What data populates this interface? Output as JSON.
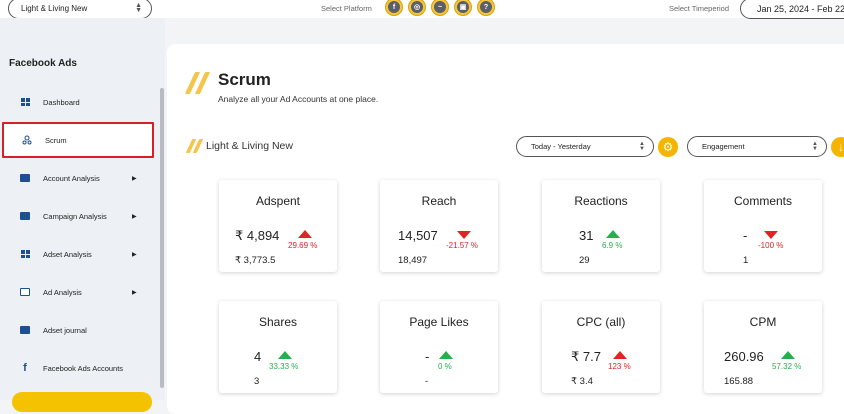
{
  "topbar": {
    "brand_select": "Light & Living New",
    "select_platform_label": "Select Platform",
    "platform_icons": [
      "facebook-icon",
      "instagram-icon",
      "messenger-icon",
      "chat-icon",
      "help-icon"
    ],
    "select_timeperiod_label": "Select Timeperiod",
    "date_range": "Jan 25, 2024 - Feb 22,"
  },
  "sidebar": {
    "title": "Facebook Ads",
    "items": [
      {
        "label": "Dashboard",
        "icon": "dashboard-icon",
        "arrow": ""
      },
      {
        "label": "Scrum",
        "icon": "scrum-icon",
        "arrow": ""
      },
      {
        "label": "Account Analysis",
        "icon": "account-icon",
        "arrow": "▶"
      },
      {
        "label": "Campaign Analysis",
        "icon": "campaign-icon",
        "arrow": "▶"
      },
      {
        "label": "Adset Analysis",
        "icon": "adset-icon",
        "arrow": "▶"
      },
      {
        "label": "Ad Analysis",
        "icon": "ad-icon",
        "arrow": "▶"
      },
      {
        "label": "Adset journal",
        "icon": "journal-icon",
        "arrow": ""
      },
      {
        "label": "Facebook Ads Accounts",
        "icon": "facebook-icon",
        "arrow": ""
      }
    ]
  },
  "main": {
    "title": "Scrum",
    "subtitle": "Analyze all your Ad Accounts at one place.",
    "account_name": "Light & Living New",
    "period_select": "Today - Yesterday",
    "metric_select": "Engagement"
  },
  "cards": [
    {
      "title": "Adspent",
      "value": "₹ 4,894",
      "prev": "₹ 3,773.5",
      "pct": "29.69 %",
      "trend": "up",
      "color": "red"
    },
    {
      "title": "Reach",
      "value": "14,507",
      "prev": "18,497",
      "pct": "-21.57 %",
      "trend": "down",
      "color": "red"
    },
    {
      "title": "Reactions",
      "value": "31",
      "prev": "29",
      "pct": "6.9 %",
      "trend": "up",
      "color": "green"
    },
    {
      "title": "Comments",
      "value": "-",
      "prev": "1",
      "pct": "-100 %",
      "trend": "down",
      "color": "red"
    },
    {
      "title": "Shares",
      "value": "4",
      "prev": "3",
      "pct": "33.33 %",
      "trend": "up",
      "color": "green"
    },
    {
      "title": "Page Likes",
      "value": "-",
      "prev": "-",
      "pct": "0 %",
      "trend": "up",
      "color": "green"
    },
    {
      "title": "CPC (all)",
      "value": "₹ 7.7",
      "prev": "₹ 3.4",
      "pct": "123 %",
      "trend": "up",
      "color": "red"
    },
    {
      "title": "CPM",
      "value": "260.96",
      "prev": "165.88",
      "pct": "57.32 %",
      "trend": "up",
      "color": "green"
    }
  ],
  "colors": {
    "accent": "#f4c54a",
    "up_good": "#22b14c",
    "bad": "#e02424",
    "sidebar_icon": "#1d4f91",
    "active_outline": "#d61f26"
  }
}
